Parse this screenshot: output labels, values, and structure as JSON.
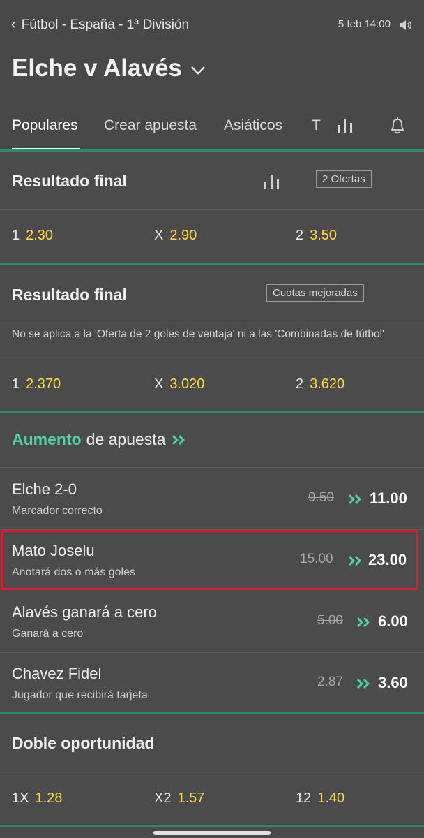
{
  "header": {
    "breadcrumb": "Fútbol - España - 1ª División",
    "datetime": "5 feb 14:00",
    "match_title": "Elche v Alavés"
  },
  "tabs": [
    {
      "label": "Populares",
      "active": true
    },
    {
      "label": "Crear apuesta",
      "active": false
    },
    {
      "label": "Asiáticos",
      "active": false
    },
    {
      "label": "T",
      "active": false
    }
  ],
  "market1": {
    "title": "Resultado final",
    "offers_badge": "2 Ofertas",
    "odds": [
      {
        "label": "1",
        "value": "2.30"
      },
      {
        "label": "X",
        "value": "2.90"
      },
      {
        "label": "2",
        "value": "3.50"
      }
    ]
  },
  "market2": {
    "title": "Resultado final",
    "badge": "Cuotas mejoradas",
    "note": "No se aplica a la 'Oferta de 2 goles de ventaja' ni a las 'Combinadas de fútbol'",
    "odds": [
      {
        "label": "1",
        "value": "2.370"
      },
      {
        "label": "X",
        "value": "3.020"
      },
      {
        "label": "2",
        "value": "3.620"
      }
    ]
  },
  "boost": {
    "title_accent": "Aumento",
    "title_rest": "de apuesta",
    "items": [
      {
        "name": "Elche 2-0",
        "sub": "Marcador correcto",
        "old": "9.50",
        "new": "11.00"
      },
      {
        "name": "Mato Joselu",
        "sub": "Anotará dos o más goles",
        "old": "15.00",
        "new": "23.00",
        "highlighted": true
      },
      {
        "name": "Alavés ganará a cero",
        "sub": "Ganará a cero",
        "old": "5.00",
        "new": "6.00"
      },
      {
        "name": "Chavez Fidel",
        "sub": "Jugador que recibirá tarjeta",
        "old": "2.87",
        "new": "3.60"
      }
    ]
  },
  "market3": {
    "title": "Doble oportunidad",
    "odds": [
      {
        "label": "1X",
        "value": "1.28"
      },
      {
        "label": "X2",
        "value": "1.57"
      },
      {
        "label": "12",
        "value": "1.40"
      }
    ]
  },
  "colors": {
    "background": "#4b4b4b",
    "odds_value": "#ffd83b",
    "accent_green": "#4fd1a5",
    "divider_green": "#2e8b6a",
    "highlight_red": "#e8192c"
  }
}
